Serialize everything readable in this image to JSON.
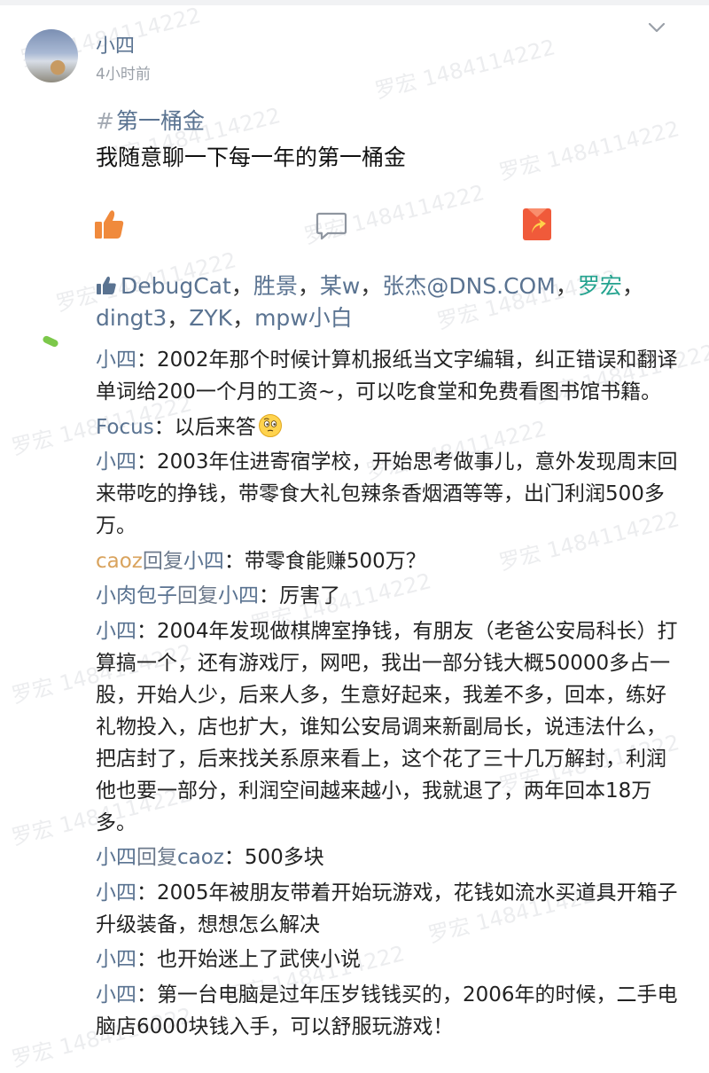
{
  "post": {
    "author": "小四",
    "time": "4小时前",
    "topic": "第一桶金",
    "topic_hash": "#",
    "title": "我随意聊一下每一年的第一桶金"
  },
  "likes": {
    "names": [
      "DebugCat",
      "胜景",
      "某w",
      "张杰@DNS.COM",
      "罗宏",
      "dingt3",
      "ZYK",
      "mpw小白"
    ],
    "separator": "，"
  },
  "comments": [
    {
      "author": "小四",
      "colon": "：",
      "text": "2002年那个时候计算机报纸当文字编辑，纠正错误和翻译单词给200一个月的工资~，可以吃食堂和免费看图书馆书籍。"
    },
    {
      "author": "Focus",
      "colon": "：",
      "text": "以后来答"
    },
    {
      "author": "小四",
      "colon": "：",
      "text": "2003年住进寄宿学校，开始思考做事儿，意外发现周末回来带吃的挣钱，带零食大礼包辣条香烟酒等等，出门利润500多万。"
    },
    {
      "author": "caoz",
      "reply_word": "回复",
      "reply_to": "小四",
      "colon": "：",
      "text": "带零食能赚500万？"
    },
    {
      "author": "小肉包子",
      "reply_word": "回复",
      "reply_to": "小四",
      "colon": "：",
      "text": "厉害了"
    },
    {
      "author": "小四",
      "colon": "：",
      "text": "2004年发现做棋牌室挣钱，有朋友（老爸公安局科长）打算搞一个，还有游戏厅，网吧，我出一部分钱大概50000多占一股，开始人少，后来人多，生意好起来，我差不多，回本，练好礼物投入，店也扩大，谁知公安局调来新副局长，说违法什么，把店封了，后来找关系原来看上，这个花了三十几万解封，利润他也要一部分，利润空间越来越小，我就退了，两年回本18万多。"
    },
    {
      "author": "小四",
      "reply_word": "回复",
      "reply_to": "caoz",
      "colon": "：",
      "text": "500多块"
    },
    {
      "author": "小四",
      "colon": "：",
      "text": "2005年被朋友带着开始玩游戏，花钱如流水买道具开箱子升级装备，想想怎么解决"
    },
    {
      "author": "小四",
      "colon": "：",
      "text": "也开始迷上了武侠小说"
    },
    {
      "author": "小四",
      "colon": "：",
      "text": "第一台电脑是过年压岁钱钱买的，2006年的时候，二手电脑店6000块钱入手，可以舒服玩游戏！"
    }
  ],
  "watermark": "罗宏 1484114222",
  "icons": {
    "like": "thumb-up-icon",
    "comment": "comment-icon",
    "share": "share-icon",
    "collapse": "chevron-down-icon",
    "emoji": "thinking-emoji-icon"
  },
  "colors": {
    "name_link": "#5a7391",
    "highlight_name": "#24a38f",
    "caoz_name": "#d9a35d",
    "like_orange": "#f08a3c",
    "share_red": "#f05a3a"
  }
}
